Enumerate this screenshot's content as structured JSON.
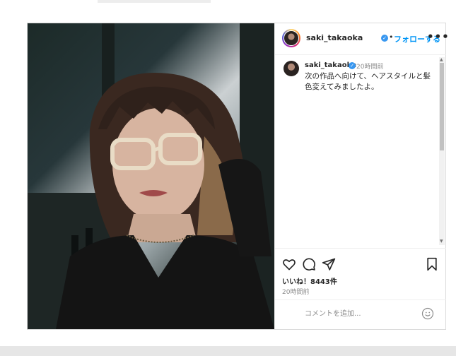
{
  "post": {
    "username": "saki_takaoka",
    "follow_label": "フォローする",
    "dot": "•",
    "more_label": "•••",
    "caption_time": "20時間前",
    "caption": "次の作品へ向けて、ヘアスタイルと髪色変えてみましたよ。",
    "likes": "いいね！8443件",
    "posted_ago": "20時間前",
    "comment_placeholder": "コメントを追加..."
  },
  "icons": {
    "verified": "verified-badge-icon",
    "like": "heart-icon",
    "comment": "comment-icon",
    "share": "send-icon",
    "save": "bookmark-icon",
    "emoji": "smiley-icon"
  },
  "colors": {
    "link": "#0095f6",
    "verified": "#3897f0",
    "muted": "#8e8e8e",
    "text": "#262626"
  }
}
